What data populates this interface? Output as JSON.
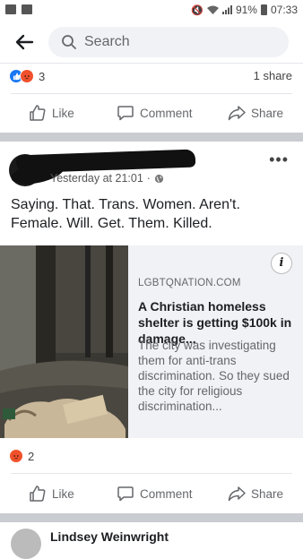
{
  "status_bar": {
    "battery": "91%",
    "time": "07:33"
  },
  "search": {
    "placeholder": "Search"
  },
  "prev_post": {
    "reaction_count": "3",
    "shares": "1 share",
    "actions": {
      "like": "Like",
      "comment": "Comment",
      "share": "Share"
    }
  },
  "post": {
    "timestamp": "Yesterday at 21:01",
    "text": "Saying. That. Trans. Women. Aren't. Female. Will. Get. Them. Killed.",
    "link": {
      "source": "LGBTQNATION.COM",
      "title": "A Christian homeless shelter is getting $100k in damage...",
      "description": "The city was investigating them for anti-trans discrimination. So they sued the city for religious discrimination..."
    },
    "reaction_count": "2",
    "actions": {
      "like": "Like",
      "comment": "Comment",
      "share": "Share"
    }
  },
  "next_post": {
    "author": "Lindsey Weinwright"
  },
  "colors": {
    "accent": "#1877f2",
    "angry": "#f0512c",
    "divider": "#c9ccd1"
  }
}
